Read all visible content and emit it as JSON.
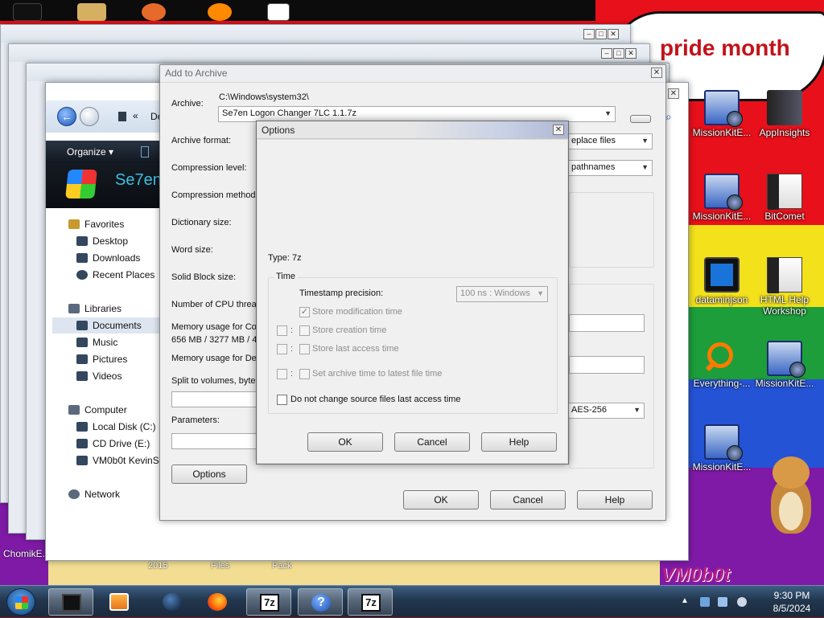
{
  "wallpaper": {
    "banner_text": "pride month",
    "signature": "VM0b0t",
    "floor_labels": [
      "2015",
      "Files",
      "Pack"
    ],
    "chomik_label": "ChomikE..."
  },
  "desktop_icons": [
    {
      "label": "MissionKitE..."
    },
    {
      "label": "AppInsights"
    },
    {
      "label": "MissionKitE..."
    },
    {
      "label": "BitComet"
    },
    {
      "label": "dataminjson"
    },
    {
      "label": "HTML Help Workshop"
    },
    {
      "label": "Everything-..."
    },
    {
      "label": "MissionKitE..."
    },
    {
      "label": "MissionKitE..."
    }
  ],
  "explorer": {
    "address_fragment": "De",
    "organize_label": "Organize ▾",
    "banner_name": "Se7en",
    "nav": {
      "favorites": "Favorites",
      "desktop": "Desktop",
      "downloads": "Downloads",
      "recent": "Recent Places",
      "libraries": "Libraries",
      "documents": "Documents",
      "music": "Music",
      "pictures": "Pictures",
      "videos": "Videos",
      "computer": "Computer",
      "local_disk": "Local Disk (C:)",
      "cd_drive": "CD Drive (E:)",
      "vm_share": "VM0b0t KevinSi",
      "network": "Network"
    }
  },
  "archive_dialog": {
    "title": "Add to Archive",
    "archive_label": "Archive:",
    "archive_path": "C:\\Windows\\system32\\",
    "archive_name": "Se7en Logon Changer 7LC 1.1.7z",
    "archive_format_label": "Archive format:",
    "compression_level_label": "Compression level:",
    "compression_method_label": "Compression method:",
    "dictionary_size_label": "Dictionary size:",
    "word_size_label": "Word size:",
    "solid_block_label": "Solid Block size:",
    "cpu_threads_label": "Number of CPU threa",
    "mem_compress_label": "Memory usage for Com",
    "mem_compress_value": "656 MB / 3277 MB / 4",
    "mem_decompress_label": "Memory usage for Dec",
    "split_label": "Split to volumes, bytes",
    "parameters_label": "Parameters:",
    "update_mode_value": "eplace files",
    "path_mode_value": "pathnames",
    "encryption_value": "AES-256",
    "options_button": "Options",
    "ok_button": "OK",
    "cancel_button": "Cancel",
    "help_button": "Help"
  },
  "options_dialog": {
    "title": "Options",
    "type_label": "Type: 7z",
    "time_group": "Time",
    "timestamp_label": "Timestamp precision:",
    "timestamp_value": "100 ns : Windows",
    "store_mtime": "Store modification time",
    "store_ctime": "Store creation time",
    "store_atime": "Store last access time",
    "set_archive_time": "Set archive time to latest file time",
    "no_change_atime": "Do not change source files last access time",
    "ok_button": "OK",
    "cancel_button": "Cancel",
    "help_button": "Help"
  },
  "taskbar": {
    "time": "9:30 PM",
    "date": "8/5/2024",
    "sevenz_glyph": "7z",
    "help_glyph": "?"
  },
  "colors": {
    "taskbar": "#22364e",
    "dialog_bg": "#f0f0f0",
    "wallpaper_red": "#e8101a"
  }
}
